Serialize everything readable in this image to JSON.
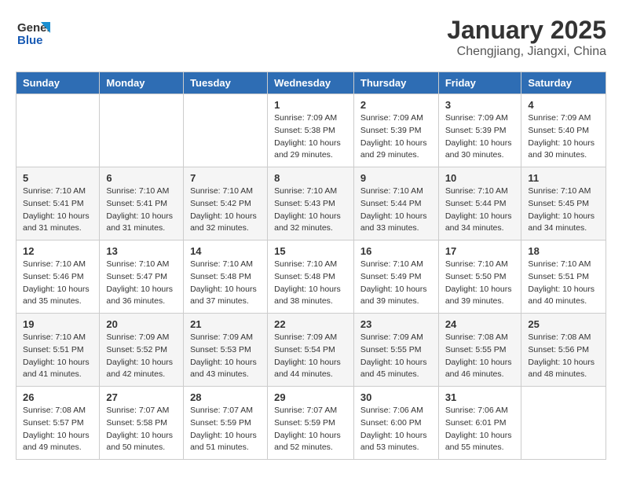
{
  "header": {
    "logo_line1": "General",
    "logo_line2": "Blue",
    "title": "January 2025",
    "subtitle": "Chengjiang, Jiangxi, China"
  },
  "weekdays": [
    "Sunday",
    "Monday",
    "Tuesday",
    "Wednesday",
    "Thursday",
    "Friday",
    "Saturday"
  ],
  "weeks": [
    [
      {
        "day": "",
        "info": ""
      },
      {
        "day": "",
        "info": ""
      },
      {
        "day": "",
        "info": ""
      },
      {
        "day": "1",
        "info": "Sunrise: 7:09 AM\nSunset: 5:38 PM\nDaylight: 10 hours\nand 29 minutes."
      },
      {
        "day": "2",
        "info": "Sunrise: 7:09 AM\nSunset: 5:39 PM\nDaylight: 10 hours\nand 29 minutes."
      },
      {
        "day": "3",
        "info": "Sunrise: 7:09 AM\nSunset: 5:39 PM\nDaylight: 10 hours\nand 30 minutes."
      },
      {
        "day": "4",
        "info": "Sunrise: 7:09 AM\nSunset: 5:40 PM\nDaylight: 10 hours\nand 30 minutes."
      }
    ],
    [
      {
        "day": "5",
        "info": "Sunrise: 7:10 AM\nSunset: 5:41 PM\nDaylight: 10 hours\nand 31 minutes."
      },
      {
        "day": "6",
        "info": "Sunrise: 7:10 AM\nSunset: 5:41 PM\nDaylight: 10 hours\nand 31 minutes."
      },
      {
        "day": "7",
        "info": "Sunrise: 7:10 AM\nSunset: 5:42 PM\nDaylight: 10 hours\nand 32 minutes."
      },
      {
        "day": "8",
        "info": "Sunrise: 7:10 AM\nSunset: 5:43 PM\nDaylight: 10 hours\nand 32 minutes."
      },
      {
        "day": "9",
        "info": "Sunrise: 7:10 AM\nSunset: 5:44 PM\nDaylight: 10 hours\nand 33 minutes."
      },
      {
        "day": "10",
        "info": "Sunrise: 7:10 AM\nSunset: 5:44 PM\nDaylight: 10 hours\nand 34 minutes."
      },
      {
        "day": "11",
        "info": "Sunrise: 7:10 AM\nSunset: 5:45 PM\nDaylight: 10 hours\nand 34 minutes."
      }
    ],
    [
      {
        "day": "12",
        "info": "Sunrise: 7:10 AM\nSunset: 5:46 PM\nDaylight: 10 hours\nand 35 minutes."
      },
      {
        "day": "13",
        "info": "Sunrise: 7:10 AM\nSunset: 5:47 PM\nDaylight: 10 hours\nand 36 minutes."
      },
      {
        "day": "14",
        "info": "Sunrise: 7:10 AM\nSunset: 5:48 PM\nDaylight: 10 hours\nand 37 minutes."
      },
      {
        "day": "15",
        "info": "Sunrise: 7:10 AM\nSunset: 5:48 PM\nDaylight: 10 hours\nand 38 minutes."
      },
      {
        "day": "16",
        "info": "Sunrise: 7:10 AM\nSunset: 5:49 PM\nDaylight: 10 hours\nand 39 minutes."
      },
      {
        "day": "17",
        "info": "Sunrise: 7:10 AM\nSunset: 5:50 PM\nDaylight: 10 hours\nand 39 minutes."
      },
      {
        "day": "18",
        "info": "Sunrise: 7:10 AM\nSunset: 5:51 PM\nDaylight: 10 hours\nand 40 minutes."
      }
    ],
    [
      {
        "day": "19",
        "info": "Sunrise: 7:10 AM\nSunset: 5:51 PM\nDaylight: 10 hours\nand 41 minutes."
      },
      {
        "day": "20",
        "info": "Sunrise: 7:09 AM\nSunset: 5:52 PM\nDaylight: 10 hours\nand 42 minutes."
      },
      {
        "day": "21",
        "info": "Sunrise: 7:09 AM\nSunset: 5:53 PM\nDaylight: 10 hours\nand 43 minutes."
      },
      {
        "day": "22",
        "info": "Sunrise: 7:09 AM\nSunset: 5:54 PM\nDaylight: 10 hours\nand 44 minutes."
      },
      {
        "day": "23",
        "info": "Sunrise: 7:09 AM\nSunset: 5:55 PM\nDaylight: 10 hours\nand 45 minutes."
      },
      {
        "day": "24",
        "info": "Sunrise: 7:08 AM\nSunset: 5:55 PM\nDaylight: 10 hours\nand 46 minutes."
      },
      {
        "day": "25",
        "info": "Sunrise: 7:08 AM\nSunset: 5:56 PM\nDaylight: 10 hours\nand 48 minutes."
      }
    ],
    [
      {
        "day": "26",
        "info": "Sunrise: 7:08 AM\nSunset: 5:57 PM\nDaylight: 10 hours\nand 49 minutes."
      },
      {
        "day": "27",
        "info": "Sunrise: 7:07 AM\nSunset: 5:58 PM\nDaylight: 10 hours\nand 50 minutes."
      },
      {
        "day": "28",
        "info": "Sunrise: 7:07 AM\nSunset: 5:59 PM\nDaylight: 10 hours\nand 51 minutes."
      },
      {
        "day": "29",
        "info": "Sunrise: 7:07 AM\nSunset: 5:59 PM\nDaylight: 10 hours\nand 52 minutes."
      },
      {
        "day": "30",
        "info": "Sunrise: 7:06 AM\nSunset: 6:00 PM\nDaylight: 10 hours\nand 53 minutes."
      },
      {
        "day": "31",
        "info": "Sunrise: 7:06 AM\nSunset: 6:01 PM\nDaylight: 10 hours\nand 55 minutes."
      },
      {
        "day": "",
        "info": ""
      }
    ]
  ]
}
